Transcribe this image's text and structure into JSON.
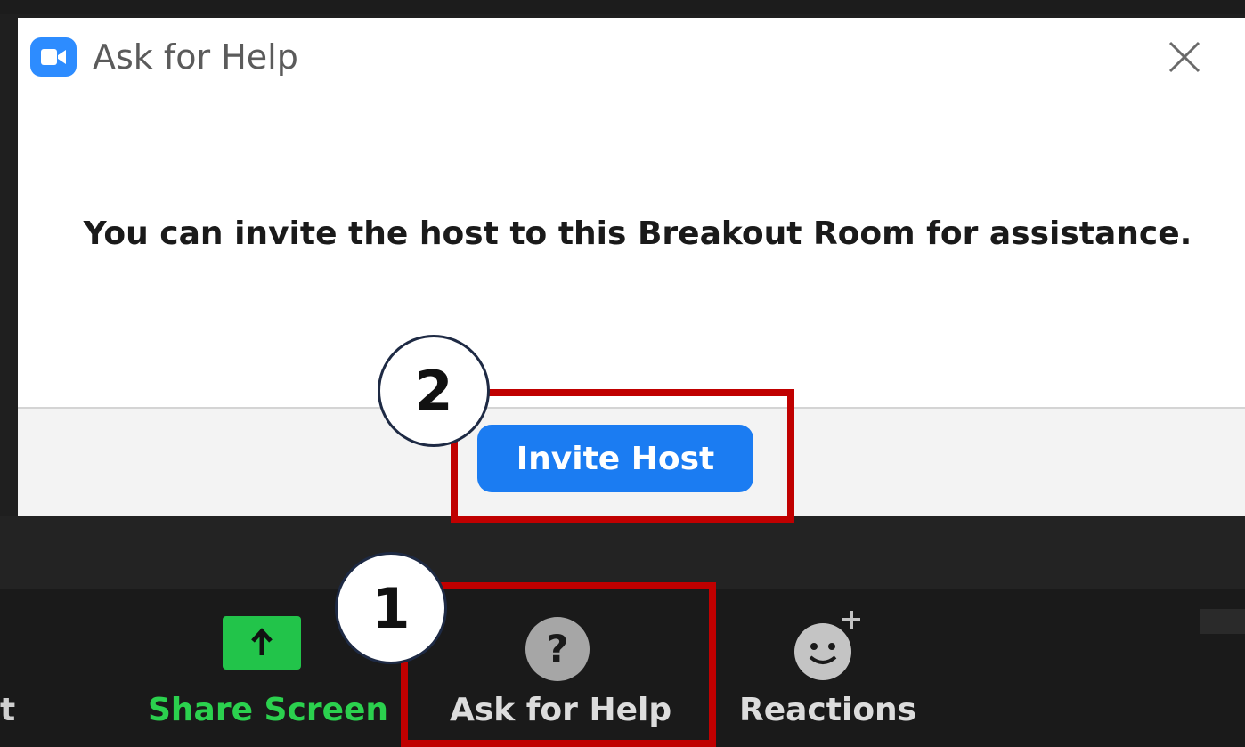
{
  "dialog": {
    "title": "Ask for Help",
    "message": "You can invite the host to this Breakout Room for assistance.",
    "invite_button": "Invite Host"
  },
  "toolbar": {
    "partial_label": "t",
    "share_screen": "Share Screen",
    "ask_for_help": "Ask for Help",
    "reactions": "Reactions"
  },
  "annotations": {
    "step1": "1",
    "step2": "2"
  },
  "icons": {
    "app": "zoom-camera-icon",
    "close": "close-icon",
    "share": "share-screen-arrow-icon",
    "help": "question-mark-icon",
    "reactions": "smiley-plus-icon"
  },
  "colors": {
    "zoom_blue": "#2d8cff",
    "button_blue": "#1b7cf2",
    "share_green": "#22c44a",
    "annotation_red": "#c00000",
    "toolbar_bg": "#1a1a1a"
  }
}
